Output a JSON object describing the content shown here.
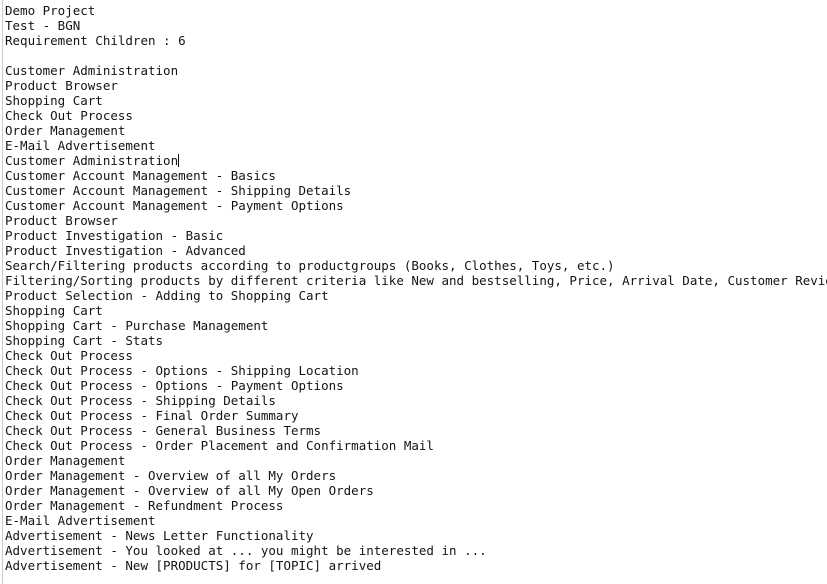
{
  "document": {
    "title": "Demo Project",
    "subtitle": "Test - BGN",
    "counter_label": "Requirement Children : 6",
    "caret_line_index": 9,
    "text_color": "#141414",
    "background_color": "#ffffff",
    "rule_color": "#c9c9d2",
    "lines": [
      "Demo Project",
      "Test - BGN",
      "Requirement Children : 6",
      "",
      "Customer Administration",
      "Product Browser",
      "Shopping Cart",
      "Check Out Process",
      "Order Management",
      "E-Mail Advertisement",
      "Customer Administration",
      "Customer Account Management - Basics",
      "Customer Account Management - Shipping Details",
      "Customer Account Management - Payment Options",
      "Product Browser",
      "Product Investigation - Basic",
      "Product Investigation - Advanced",
      "Search/Filtering products according to productgroups (Books, Clothes, Toys, etc.)",
      "Filtering/Sorting products by different criteria like New and bestselling, Price, Arrival Date, Customer Review",
      "Product Selection - Adding to Shopping Cart",
      "Shopping Cart",
      "Shopping Cart - Purchase Management",
      "Shopping Cart - Stats",
      "Check Out Process",
      "Check Out Process - Options - Shipping Location",
      "Check Out Process - Options - Payment Options",
      "Check Out Process - Shipping Details",
      "Check Out Process - Final Order Summary",
      "Check Out Process - General Business Terms",
      "Check Out Process - Order Placement and Confirmation Mail",
      "Order Management",
      "Order Management - Overview of all My Orders",
      "Order Management - Overview of all My Open Orders",
      "Order Management - Refundment Process",
      "E-Mail Advertisement",
      "Advertisement - News Letter Functionality",
      "Advertisement - You looked at ... you might be interested in ...",
      "Advertisement - New [PRODUCTS] for [TOPIC] arrived"
    ]
  }
}
